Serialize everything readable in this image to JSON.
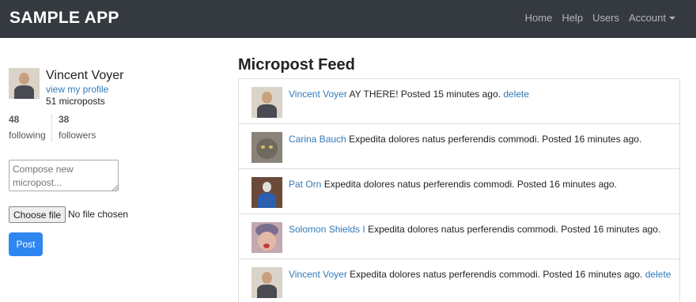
{
  "navbar": {
    "brand": "SAMPLE APP",
    "links": [
      "Home",
      "Help",
      "Users",
      "Account"
    ]
  },
  "profile": {
    "name": "Vincent Voyer",
    "view_profile": "view my profile",
    "micropost_count": "51 microposts",
    "following_count": "48",
    "following_label": "following",
    "followers_count": "38",
    "followers_label": "followers"
  },
  "composer": {
    "placeholder": "Compose new micropost...",
    "choose_file": "Choose file",
    "file_status": "No file chosen",
    "post_label": "Post"
  },
  "feed": {
    "title": "Micropost Feed",
    "items": [
      {
        "user": "Vincent Voyer",
        "content": "AY THERE!",
        "time": "Posted 15 minutes ago.",
        "delete": "delete",
        "avatar_icon": "man-avatar-icon"
      },
      {
        "user": "Carina Bauch",
        "content": "Expedita dolores natus perferendis commodi.",
        "time": "Posted 16 minutes ago.",
        "delete": "",
        "avatar_icon": "cat-avatar-icon"
      },
      {
        "user": "Pat Orn",
        "content": "Expedita dolores natus perferendis commodi.",
        "time": "Posted 16 minutes ago.",
        "delete": "",
        "avatar_icon": "person-blue-avatar-icon"
      },
      {
        "user": "Solomon Shields I",
        "content": "Expedita dolores natus perferendis commodi.",
        "time": "Posted 16 minutes ago.",
        "delete": "",
        "avatar_icon": "child-avatar-icon"
      },
      {
        "user": "Vincent Voyer",
        "content": "Expedita dolores natus perferendis commodi.",
        "time": "Posted 16 minutes ago.",
        "delete": "delete",
        "avatar_icon": "man-avatar-icon"
      }
    ]
  },
  "colors": {
    "navbar_bg": "#343a40",
    "link": "#337ab7",
    "button_primary": "#2e86f0"
  }
}
